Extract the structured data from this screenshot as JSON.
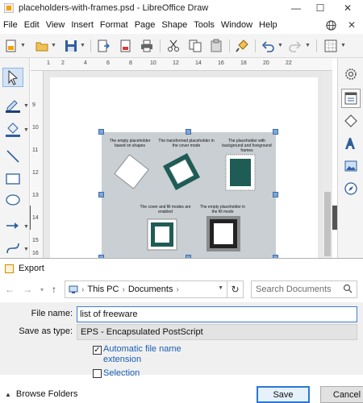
{
  "window": {
    "title": "placeholders-with-frames.psd - LibreOffice Draw",
    "minimize_glyph": "—",
    "maximize_glyph": "☐",
    "close_glyph": "✕"
  },
  "menubar": {
    "items": [
      "File",
      "Edit",
      "View",
      "Insert",
      "Format",
      "Page",
      "Shape",
      "Tools",
      "Window",
      "Help"
    ],
    "globe_icon": "globe-icon",
    "close_doc_glyph": "✕"
  },
  "toolbar": {
    "icons": [
      "select-icon",
      "new-document-icon",
      "open-folder-icon",
      "save-icon",
      "export-icon",
      "export-pdf-icon",
      "print-icon",
      "cut-icon",
      "copy-icon",
      "paste-icon",
      "clone-formatting-icon",
      "undo-icon",
      "redo-icon",
      "grid-icon"
    ]
  },
  "rulers": {
    "horizontal": [
      "1",
      "2",
      "4",
      "6",
      "8",
      "10",
      "12",
      "14",
      "16",
      "18",
      "20",
      "22"
    ],
    "vertical": [
      "9",
      "10",
      "11",
      "12",
      "13",
      "14",
      "15",
      "16",
      "17"
    ]
  },
  "canvas": {
    "captions": [
      "The empty placeholder based on shapes",
      "The transformed placeholder in the cover mode",
      "The placeholder with background and foreground frames",
      "The cover and fill modes are enabled",
      "The empty placeholder in the fill mode"
    ],
    "accent_color": "#1f5c55",
    "artboard_color": "#c9cfd3"
  },
  "leftbar": {
    "icons": [
      "select-icon",
      "line-color-icon",
      "fill-color-icon",
      "line-icon",
      "rectangle-icon",
      "ellipse-icon",
      "arrow-line-icon",
      "curve-icon"
    ]
  },
  "rightbar": {
    "icons": [
      "settings-icon",
      "properties-icon",
      "shapes-icon",
      "fontwork-icon",
      "gallery-icon",
      "navigator-icon"
    ]
  },
  "dialog": {
    "title": "Export",
    "breadcrumb": [
      "This PC",
      "Documents"
    ],
    "search_placeholder": "Search Documents",
    "file_name_label": "File name:",
    "file_name_value": "list of freeware",
    "save_as_type_label": "Save as type:",
    "save_as_type_value": "EPS - Encapsulated PostScript",
    "auto_ext_label": "Automatic file name extension",
    "auto_ext_checked": true,
    "selection_label": "Selection",
    "selection_checked": false,
    "browse_folders_label": "Browse Folders",
    "save_label": "Save",
    "cancel_label": "Cancel"
  }
}
